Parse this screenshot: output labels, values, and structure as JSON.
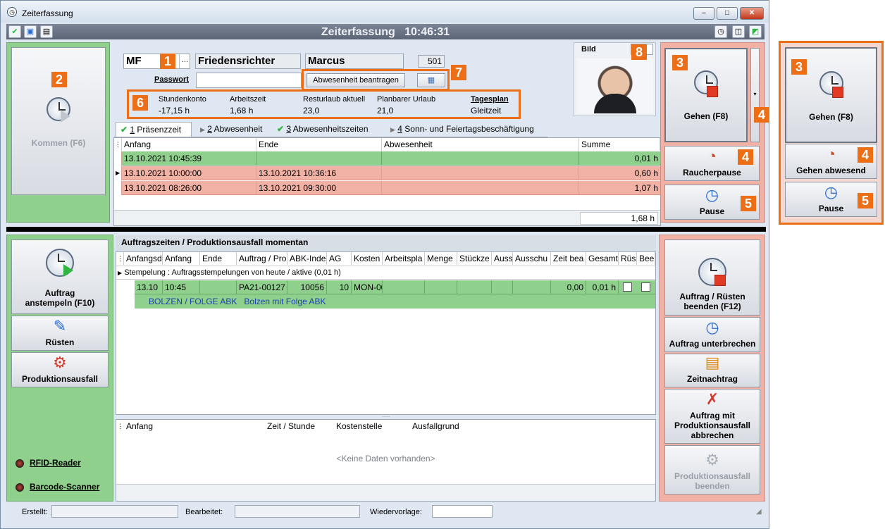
{
  "window": {
    "title": "Zeiterfassung",
    "min": "–",
    "max": "□",
    "close": "✕"
  },
  "toolbar": {
    "title": "Zeiterfassung",
    "time": "10:46:31"
  },
  "left": {
    "kommen": "Kommen (F6)"
  },
  "employee": {
    "code": "MF",
    "dots": "…",
    "lastname": "Friedensrichter",
    "firstname": "Marcus",
    "number": "501",
    "password_label": "Passwort",
    "absence_button": "Abwesenheit beantragen",
    "photo_label": "Bild"
  },
  "stats": [
    {
      "label": "Stundenkonto",
      "value": "-17,15 h"
    },
    {
      "label": "Arbeitszeit",
      "value": "1,68 h"
    },
    {
      "label": "Resturlaub aktuell",
      "value": "23,0"
    },
    {
      "label": "Planbarer Urlaub",
      "value": "21,0"
    },
    {
      "label": "Tagesplan",
      "value": "Gleitzeit"
    }
  ],
  "tabs": [
    {
      "num": "1",
      "label": " Präsenzzeit"
    },
    {
      "num": "2",
      "label": " Abwesenheit"
    },
    {
      "num": "3",
      "label": " Abwesenheitszeiten"
    },
    {
      "num": "4",
      "label": " Sonn- und Feiertagsbeschäftigung"
    }
  ],
  "presence": {
    "headers": [
      "Anfang",
      "Ende",
      "Abwesenheit",
      "Summe"
    ],
    "rows": [
      {
        "anfang": "13.10.2021 10:45:39",
        "ende": "",
        "abw": "",
        "summe": "0,01 h"
      },
      {
        "anfang": "13.10.2021 10:00:00",
        "ende": "13.10.2021 10:36:16",
        "abw": "",
        "summe": "0,60 h"
      },
      {
        "anfang": "13.10.2021 08:26:00",
        "ende": "13.10.2021 09:30:00",
        "abw": "",
        "summe": "1,07 h"
      }
    ],
    "total": "1,68 h"
  },
  "right_top": {
    "gehen": "Gehen (F8)",
    "raucher": "Raucherpause",
    "pause": "Pause"
  },
  "callout": {
    "gehen": "Gehen (F8)",
    "gehen_abw": "Gehen abwesend",
    "pause": "Pause"
  },
  "badges": [
    "1",
    "2",
    "3",
    "4",
    "5",
    "6",
    "7",
    "8"
  ],
  "orders": {
    "title": "Auftragszeiten / Produktionsausfall momentan",
    "headers": [
      "Anfangsd",
      "Anfang",
      "Ende",
      "Auftrag / Pro",
      "ABK-Index",
      "AG",
      "Kosten",
      "Arbeitspla",
      "Menge",
      "Stückze",
      "Auss",
      "Ausschu",
      "Zeit bea",
      "Gesamt",
      "Rüs",
      "Bee"
    ],
    "group": "Stempelung : Auftragsstempelungen von heute / aktive (0,01 h)",
    "row": {
      "date": "13.10",
      "start": "10:45",
      "end": "",
      "order": "PA21-00127",
      "abk": "10056",
      "ag": "10",
      "kosten": "MON-00",
      "zeit": "0,00",
      "gesamt": "0,01 h"
    },
    "sub": {
      "a": "BOLZEN / FOLGE ABK",
      "b": "Bolzen mit Folge ABK"
    }
  },
  "downtime": {
    "headers": [
      "Anfang",
      "Zeit / Stunde",
      "Kostenstelle",
      "Ausfallgrund"
    ],
    "empty": "<Keine Daten vorhanden>"
  },
  "left_bottom": {
    "anstempeln": "Auftrag anstempeln (F10)",
    "ruesten": "Rüsten",
    "prodausfall": "Produktionsausfall",
    "rfid": "RFID-Reader",
    "barcode": "Barcode-Scanner"
  },
  "right_bottom": {
    "beenden": "Auftrag / Rüsten beenden (F12)",
    "unterbrechen": "Auftrag unterbrechen",
    "nachtrag": "Zeitnachtrag",
    "abbrechen": "Auftrag mit Produktionsausfall abbrechen",
    "pa_beenden": "Produktionsausfall beenden"
  },
  "statusbar": {
    "erstellt": "Erstellt:",
    "bearbeitet": "Bearbeitet:",
    "wiedervorlage": "Wiedervorlage:"
  },
  "colors": {
    "green": "#90d08d",
    "red": "#f2b1a5",
    "accent": "#ec6e16"
  }
}
